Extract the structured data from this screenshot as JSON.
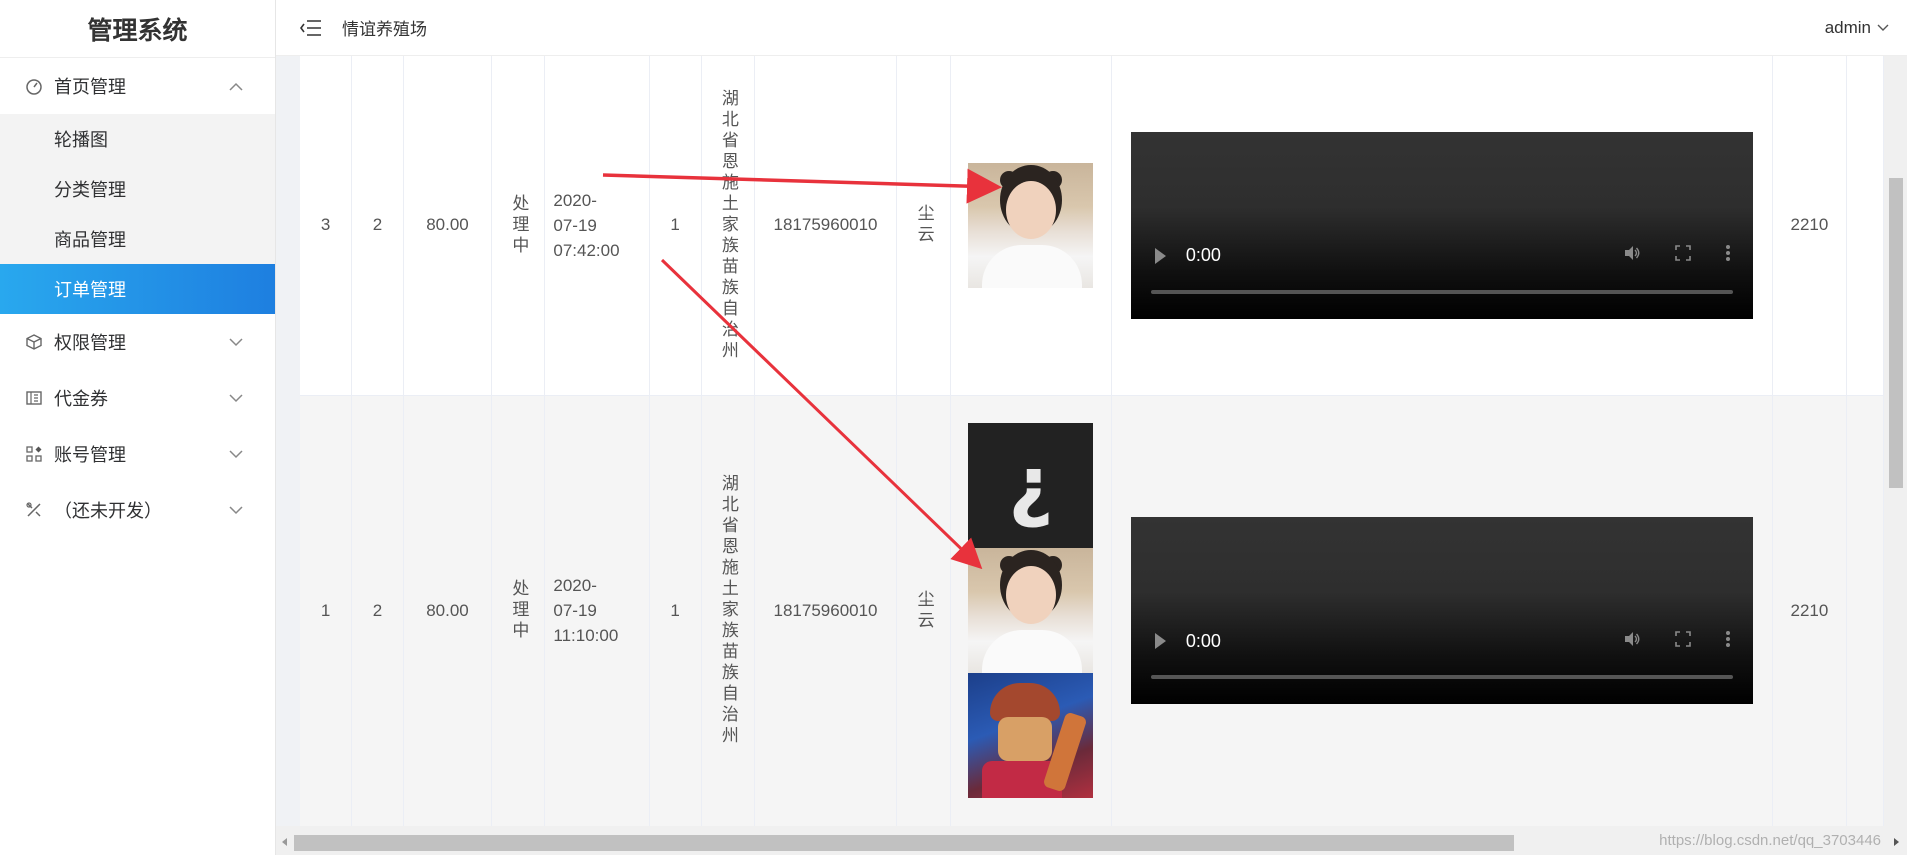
{
  "app": {
    "title": "管理系统"
  },
  "sidebar": {
    "groups": [
      {
        "label": "首页管理",
        "icon": "dashboard-icon",
        "expanded": true,
        "items": [
          {
            "label": "轮播图",
            "active": false
          },
          {
            "label": "分类管理",
            "active": false
          },
          {
            "label": "商品管理",
            "active": false
          },
          {
            "label": "订单管理",
            "active": true
          }
        ]
      },
      {
        "label": "权限管理",
        "icon": "cube-icon",
        "expanded": false
      },
      {
        "label": "代金券",
        "icon": "coupon-icon",
        "expanded": false
      },
      {
        "label": "账号管理",
        "icon": "grid-icon",
        "expanded": false
      },
      {
        "label": "（还未开发）",
        "icon": "tools-icon",
        "expanded": false
      }
    ]
  },
  "header": {
    "title": "情谊养殖场",
    "user": "admin"
  },
  "table": {
    "rows": [
      {
        "id": "3",
        "qty": "2",
        "price": "80.00",
        "status": "处理中",
        "date": "2020-",
        "date2": "07-19",
        "time": "07:42:00",
        "type": "1",
        "address": "湖北省恩施土家族苗族自治州",
        "phone": "18175960010",
        "name": "尘云",
        "images": [
          "photo-girl"
        ],
        "video_time": "0:00",
        "code": "2210"
      },
      {
        "id": "1",
        "qty": "2",
        "price": "80.00",
        "status": "处理中",
        "date": "2020-",
        "date2": "07-19",
        "time": "11:10:00",
        "type": "1",
        "address": "湖北省恩施土家族苗族自治州",
        "phone": "18175960010",
        "name": "尘云",
        "images": [
          "photo-broken",
          "photo-girl",
          "photo-robot"
        ],
        "video_time": "0:00",
        "code": "2210"
      }
    ]
  },
  "broken_image_glyph": "¿",
  "watermark": "https://blog.csdn.net/qq_3703446",
  "colors": {
    "active_start": "#29a8ee",
    "active_end": "#1e7fe0",
    "arrow": "#e8323c"
  }
}
